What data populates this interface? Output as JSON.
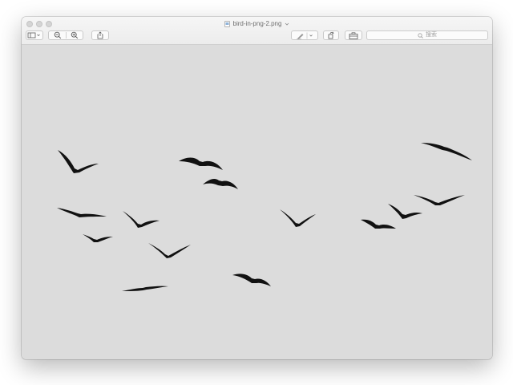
{
  "window": {
    "title": "bird-in-png-2.png"
  },
  "toolbar": {
    "sidebar_button": "sidebar-icon",
    "zoom_out": "zoom-out-icon",
    "zoom_in": "zoom-in-icon",
    "share": "share-icon",
    "markup": "markup-pen-icon",
    "rotate": "rotate-icon",
    "toolbox": "toolbox-icon"
  },
  "search": {
    "placeholder": "搜索"
  },
  "image": {
    "description_colors": {
      "background": "#dcdcdc",
      "bird": "#111111"
    }
  }
}
